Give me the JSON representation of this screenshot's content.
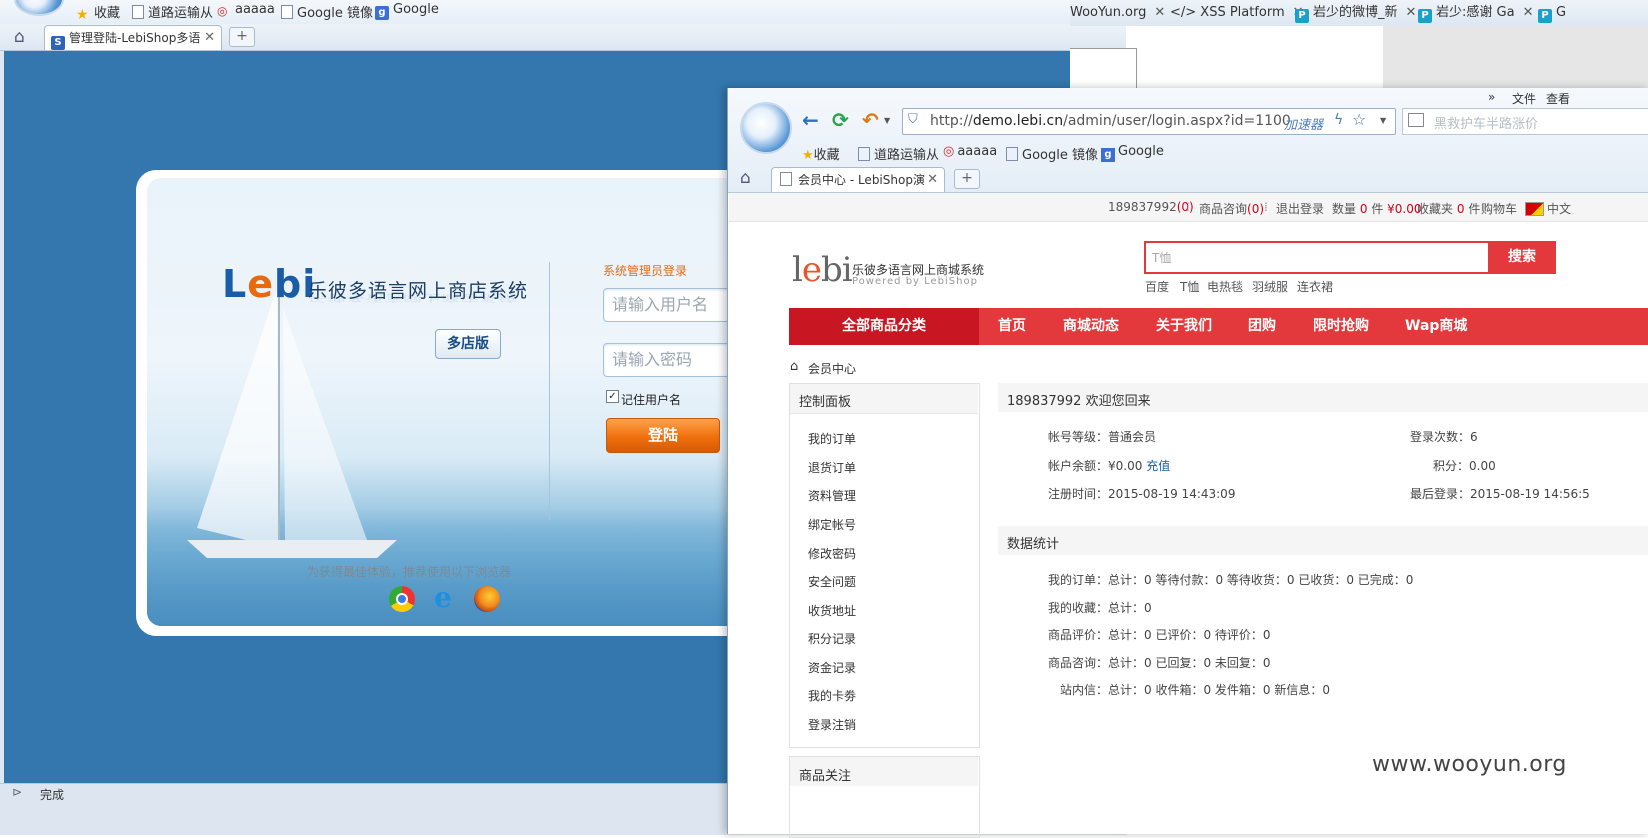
{
  "back_window": {
    "bookmarks": [
      {
        "icon": "star-icon",
        "label": "收藏"
      },
      {
        "icon": "page-icon",
        "label": "道路运输从"
      },
      {
        "icon": "weibo-icon",
        "label": "aaaaa"
      },
      {
        "icon": "page-icon",
        "label": "Google 镜像"
      },
      {
        "icon": "google-icon",
        "label": "Google"
      }
    ],
    "active_tab": "管理登陆-LebiShop多语",
    "right_tabs": [
      "WooYun.org",
      "</> XSS Platform",
      "岩少的微博_新",
      "岩少:感谢 Ga",
      "G"
    ],
    "brand": {
      "logo_text_l": "L",
      "logo_text_e": "e",
      "logo_text_bi": "bi",
      "title": "乐彼多语言网上商店系统"
    },
    "multi_store_button": "多店版",
    "admin_login_label": "系统管理员登录",
    "username_placeholder": "请输入用户名",
    "password_placeholder": "请输入密码",
    "remember_label": "记住用户名",
    "login_button": "登陆",
    "browser_tip": "为获得最佳体验，推荐使用以下浏览器",
    "status": "完成"
  },
  "front_window": {
    "menu": [
      "文件",
      "查看"
    ],
    "url_prefix": "http://",
    "url_host": "demo.lebi.cn",
    "url_path": "/admin/user/login.aspx?id=1100",
    "accelerator": "加速器",
    "search_placeholder": "黑救护车半路涨价",
    "bookmarks": [
      "收藏",
      "道路运输从",
      "aaaaa",
      "Google 镜像",
      "Google"
    ],
    "active_tab": "会员中心 - LebiShop演",
    "topbar": {
      "user": "189837992",
      "user_count": "(0)",
      "consult": "商品咨询",
      "consult_count": "(0)",
      "logout": "退出登录",
      "qty_label": "数量",
      "qty": "0",
      "piece": "件",
      "amount": "¥0.00",
      "fav_label": "收藏夹",
      "fav": "0",
      "fav_piece": "件",
      "cart": "购物车",
      "lang": "中文"
    },
    "shop": {
      "logo_l": "l",
      "logo_e": "e",
      "logo_bi": "bi",
      "name": "乐彼多语言网上商城系统",
      "powered": "Powered by LebiShop",
      "search_keyword": "T恤",
      "search_button": "搜索",
      "hot_words": [
        "百度",
        "T恤",
        "电热毯",
        "羽绒服",
        "连衣裙"
      ]
    },
    "nav": {
      "category": "全部商品分类",
      "items": [
        "首页",
        "商城动态",
        "关于我们",
        "团购",
        "限时抢购",
        "Wap商城"
      ]
    },
    "breadcrumb": "会员中心",
    "sidebar": {
      "title": "控制面板",
      "items": [
        "我的订单",
        "退货订单",
        "资料管理",
        "绑定帐号",
        "修改密码",
        "安全问题",
        "收货地址",
        "积分记录",
        "资金记录",
        "我的卡劵",
        "登录注销"
      ],
      "second_title": "商品关注"
    },
    "welcome": "189837992 欢迎您回来",
    "account": {
      "level": "帐号等级：普通会员",
      "balance_label": "帐户余额：¥0.00",
      "recharge": "充值",
      "register": "注册时间：2015-08-19 14:43:09",
      "login_count": "登录次数：6",
      "points": "积分：0.00",
      "last_login": "最后登录：2015-08-19 14:56:5"
    },
    "stats_title": "数据统计",
    "stats": [
      "我的订单：总计：0 等待付款：0 等待收货：0 已收货：0 已完成：0",
      "我的收藏：总计：0",
      "商品评价：总计：0 已评价：0 待评价：0",
      "商品咨询：总计：0 已回复：0  未回复：0",
      "站内信：总计：0 收件箱：0 发件箱：0 新信息：0"
    ]
  },
  "watermark": "www.wooyun.org"
}
